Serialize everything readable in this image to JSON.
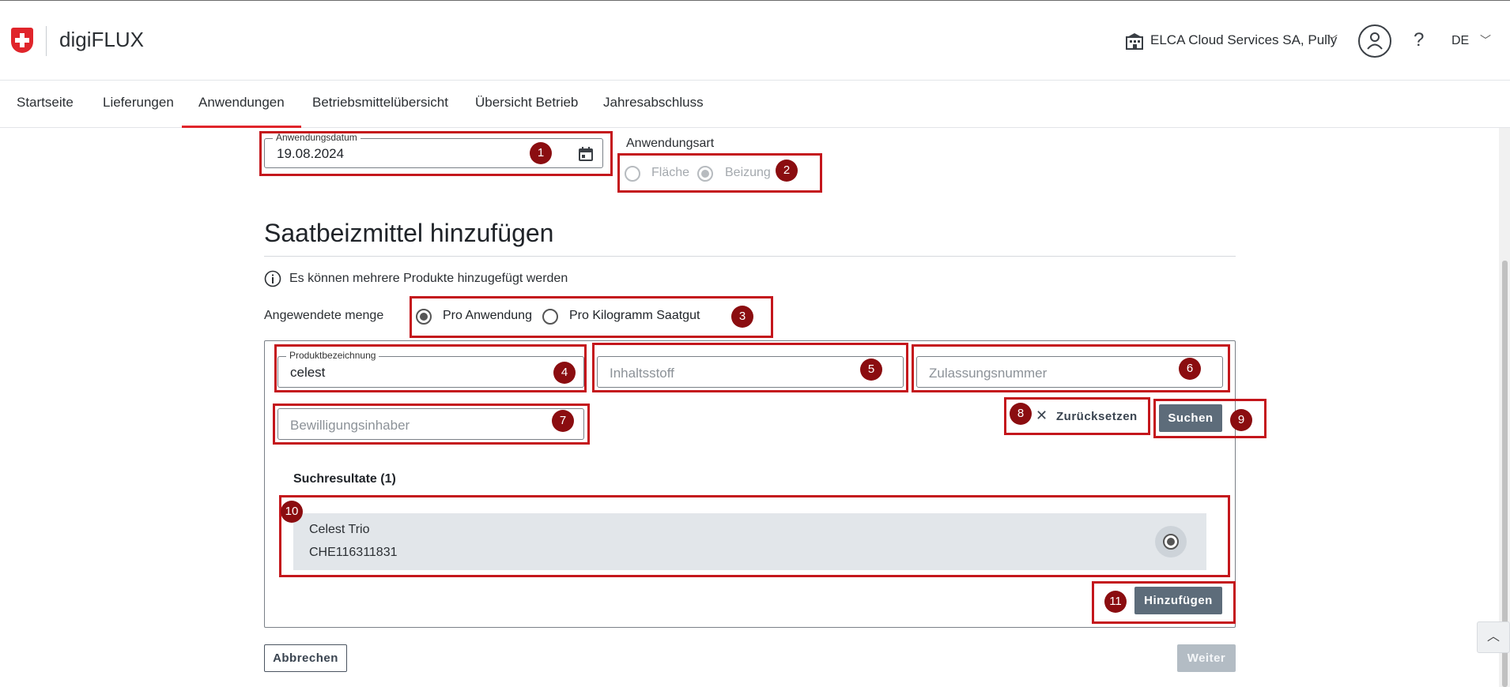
{
  "header": {
    "app_title": "digiFLUX",
    "org_name": "ELCA Cloud Services SA, Pully",
    "help": "?",
    "language": "DE"
  },
  "nav": {
    "tabs": [
      {
        "label": "Startseite"
      },
      {
        "label": "Lieferungen"
      },
      {
        "label": "Anwendungen"
      },
      {
        "label": "Betriebsmittelübersicht"
      },
      {
        "label": "Übersicht Betrieb"
      },
      {
        "label": "Jahresabschluss"
      }
    ],
    "active": "Anwendungen"
  },
  "form": {
    "date_label": "Anwendungsdatum",
    "date_value": "19.08.2024",
    "type_label": "Anwendungsart",
    "type_options": [
      "Fläche",
      "Beizung"
    ],
    "type_selected": "Beizung",
    "section_title": "Saatbeizmittel hinzufügen",
    "info_text": "Es können mehrere Produkte hinzugefügt werden",
    "quantity_label": "Angewendete menge",
    "quantity_options": [
      "Pro Anwendung",
      "Pro Kilogramm Saatgut"
    ],
    "quantity_selected": "Pro Anwendung"
  },
  "search": {
    "product_label": "Produktbezeichnung",
    "product_value": "celest",
    "ingredient_placeholder": "Inhaltsstoff",
    "approval_placeholder": "Zulassungsnummer",
    "holder_placeholder": "Bewilligungsinhaber",
    "reset_label": "Zurücksetzen",
    "search_label": "Suchen",
    "results_title": "Suchresultate (1)",
    "results": [
      {
        "name": "Celest Trio",
        "code": "CHE116311831"
      }
    ],
    "add_label": "Hinzufügen"
  },
  "footer": {
    "cancel_label": "Abbrechen",
    "next_label": "Weiter"
  },
  "markers": [
    "1",
    "2",
    "3",
    "4",
    "5",
    "6",
    "7",
    "8",
    "9",
    "10",
    "11"
  ],
  "colors": {
    "accent_red": "#e0252b",
    "annotation_red": "#c4161c",
    "marker_dark_red": "#8b0d10",
    "button_slate": "#5d6c7a"
  }
}
